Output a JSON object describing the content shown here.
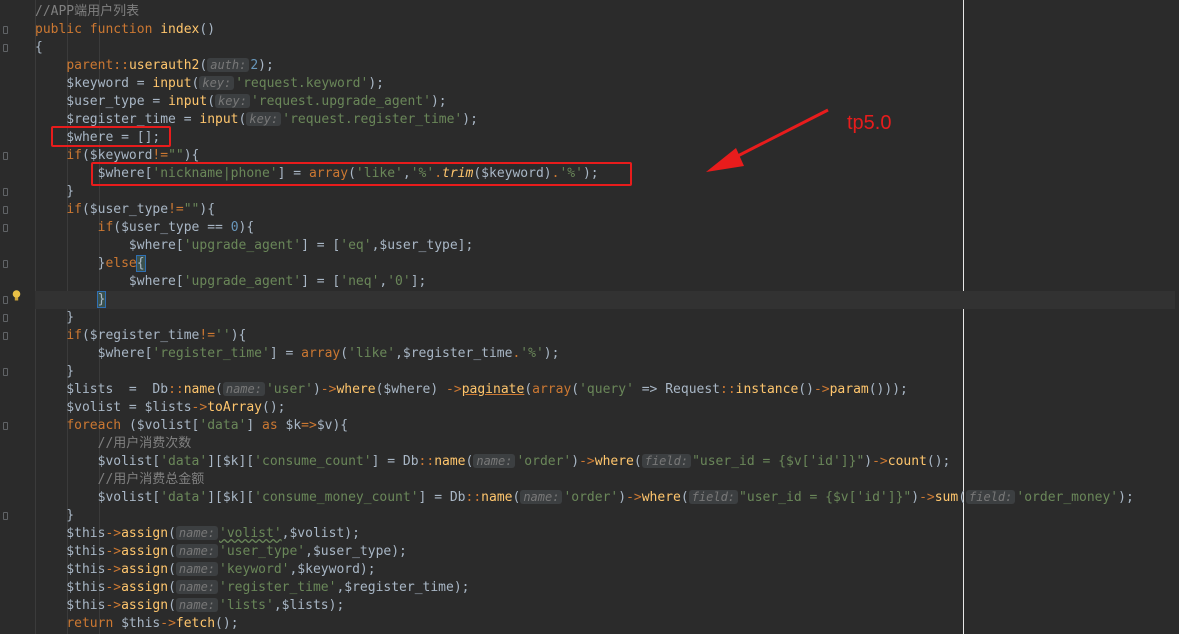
{
  "annotation": {
    "label": "tp5.0",
    "color": "#e81c1c"
  },
  "lines": [
    [
      {
        "c": "cm",
        "t": "//APP端用户列表"
      }
    ],
    [
      {
        "c": "kw",
        "t": "public function "
      },
      {
        "c": "fn",
        "t": "index"
      },
      {
        "c": "var",
        "t": "()"
      }
    ],
    [
      {
        "c": "var",
        "t": "{"
      }
    ],
    [
      {
        "c": "var",
        "t": "    "
      },
      {
        "c": "kw",
        "t": "parent"
      },
      {
        "c": "op",
        "t": "::"
      },
      {
        "c": "mth",
        "t": "userauth2"
      },
      {
        "c": "var",
        "t": "("
      },
      {
        "c": "hint",
        "t": "auth:"
      },
      {
        "c": "num",
        "t": "2"
      },
      {
        "c": "var",
        "t": ");"
      }
    ],
    [
      {
        "c": "var",
        "t": "    $keyword = "
      },
      {
        "c": "mth",
        "t": "input"
      },
      {
        "c": "var",
        "t": "("
      },
      {
        "c": "hint",
        "t": "key:"
      },
      {
        "c": "str",
        "t": "'request.keyword'"
      },
      {
        "c": "var",
        "t": ");"
      }
    ],
    [
      {
        "c": "var",
        "t": "    $user_type = "
      },
      {
        "c": "mth",
        "t": "input"
      },
      {
        "c": "var",
        "t": "("
      },
      {
        "c": "hint",
        "t": "key:"
      },
      {
        "c": "str",
        "t": "'request.upgrade_agent'"
      },
      {
        "c": "var",
        "t": ");"
      }
    ],
    [
      {
        "c": "var",
        "t": "    $register_time = "
      },
      {
        "c": "mth",
        "t": "input"
      },
      {
        "c": "var",
        "t": "("
      },
      {
        "c": "hint",
        "t": "key:"
      },
      {
        "c": "str",
        "t": "'request.register_time'"
      },
      {
        "c": "var",
        "t": ");"
      }
    ],
    [
      {
        "c": "var",
        "t": "    $where = [];"
      }
    ],
    [
      {
        "c": "var",
        "t": "    "
      },
      {
        "c": "kw",
        "t": "if"
      },
      {
        "c": "var",
        "t": "($keyword"
      },
      {
        "c": "op",
        "t": "!="
      },
      {
        "c": "str",
        "t": "\"\""
      },
      {
        "c": "var",
        "t": "){"
      }
    ],
    [
      {
        "c": "var",
        "t": "        $where["
      },
      {
        "c": "str",
        "t": "'nickname|phone'"
      },
      {
        "c": "var",
        "t": "] = "
      },
      {
        "c": "kw",
        "t": "array"
      },
      {
        "c": "var",
        "t": "("
      },
      {
        "c": "str",
        "t": "'like'"
      },
      {
        "c": "var",
        "t": ","
      },
      {
        "c": "str",
        "t": "'%'"
      },
      {
        "c": "op",
        "t": "."
      },
      {
        "c": "mth ital",
        "t": "trim"
      },
      {
        "c": "var",
        "t": "($keyword)"
      },
      {
        "c": "op",
        "t": "."
      },
      {
        "c": "str",
        "t": "'%'"
      },
      {
        "c": "var",
        "t": ");"
      }
    ],
    [
      {
        "c": "var",
        "t": "    }"
      }
    ],
    [
      {
        "c": "var",
        "t": "    "
      },
      {
        "c": "kw",
        "t": "if"
      },
      {
        "c": "var",
        "t": "($user_type"
      },
      {
        "c": "op",
        "t": "!="
      },
      {
        "c": "str",
        "t": "\"\""
      },
      {
        "c": "var",
        "t": "){"
      }
    ],
    [
      {
        "c": "var",
        "t": "        "
      },
      {
        "c": "kw",
        "t": "if"
      },
      {
        "c": "var",
        "t": "($user_type == "
      },
      {
        "c": "num",
        "t": "0"
      },
      {
        "c": "var",
        "t": "){"
      }
    ],
    [
      {
        "c": "var",
        "t": "            $where["
      },
      {
        "c": "str",
        "t": "'upgrade_agent'"
      },
      {
        "c": "var",
        "t": "] = ["
      },
      {
        "c": "str",
        "t": "'eq'"
      },
      {
        "c": "var",
        "t": ",$user_type];"
      }
    ],
    [
      {
        "c": "var",
        "t": "        }"
      },
      {
        "c": "kw",
        "t": "else"
      },
      {
        "c": "brace",
        "t": "{"
      }
    ],
    [
      {
        "c": "var",
        "t": "            $where["
      },
      {
        "c": "str",
        "t": "'upgrade_agent'"
      },
      {
        "c": "var",
        "t": "] = ["
      },
      {
        "c": "str",
        "t": "'neq'"
      },
      {
        "c": "var",
        "t": ","
      },
      {
        "c": "str",
        "t": "'0'"
      },
      {
        "c": "var",
        "t": "];"
      }
    ],
    [
      {
        "c": "var",
        "t": "        "
      },
      {
        "c": "brace",
        "t": "}"
      }
    ],
    [
      {
        "c": "var",
        "t": "    }"
      }
    ],
    [
      {
        "c": "var",
        "t": "    "
      },
      {
        "c": "kw",
        "t": "if"
      },
      {
        "c": "var",
        "t": "($register_time"
      },
      {
        "c": "op",
        "t": "!="
      },
      {
        "c": "str",
        "t": "''"
      },
      {
        "c": "var",
        "t": "){"
      }
    ],
    [
      {
        "c": "var",
        "t": "        $where["
      },
      {
        "c": "str",
        "t": "'register_time'"
      },
      {
        "c": "var",
        "t": "] = "
      },
      {
        "c": "kw",
        "t": "array"
      },
      {
        "c": "var",
        "t": "("
      },
      {
        "c": "str",
        "t": "'like'"
      },
      {
        "c": "var",
        "t": ",$register_time"
      },
      {
        "c": "op",
        "t": "."
      },
      {
        "c": "str",
        "t": "'%'"
      },
      {
        "c": "var",
        "t": ");"
      }
    ],
    [
      {
        "c": "var",
        "t": "    }"
      }
    ],
    [
      {
        "c": "var",
        "t": "    $lists  =  Db"
      },
      {
        "c": "op",
        "t": "::"
      },
      {
        "c": "mth",
        "t": "name"
      },
      {
        "c": "var",
        "t": "("
      },
      {
        "c": "hint",
        "t": "name:"
      },
      {
        "c": "str",
        "t": "'user'"
      },
      {
        "c": "var",
        "t": ")"
      },
      {
        "c": "op",
        "t": "->"
      },
      {
        "c": "mth",
        "t": "where"
      },
      {
        "c": "var",
        "t": "($where) "
      },
      {
        "c": "op",
        "t": "->"
      },
      {
        "c": "mth under",
        "t": "paginate"
      },
      {
        "c": "var",
        "t": "("
      },
      {
        "c": "kw",
        "t": "array"
      },
      {
        "c": "var",
        "t": "("
      },
      {
        "c": "str",
        "t": "'query'"
      },
      {
        "c": "var",
        "t": " => Request"
      },
      {
        "c": "op",
        "t": "::"
      },
      {
        "c": "mth",
        "t": "instance"
      },
      {
        "c": "var",
        "t": "()"
      },
      {
        "c": "op",
        "t": "->"
      },
      {
        "c": "mth",
        "t": "param"
      },
      {
        "c": "var",
        "t": "()));"
      }
    ],
    [
      {
        "c": "var",
        "t": "    $volist = $lists"
      },
      {
        "c": "op",
        "t": "->"
      },
      {
        "c": "mth",
        "t": "toArray"
      },
      {
        "c": "var",
        "t": "();"
      }
    ],
    [
      {
        "c": "var",
        "t": "    "
      },
      {
        "c": "kw",
        "t": "foreach "
      },
      {
        "c": "var",
        "t": "($volist["
      },
      {
        "c": "str",
        "t": "'data'"
      },
      {
        "c": "var",
        "t": "] "
      },
      {
        "c": "kw",
        "t": "as "
      },
      {
        "c": "var",
        "t": "$k"
      },
      {
        "c": "op",
        "t": "=>"
      },
      {
        "c": "var",
        "t": "$v){"
      }
    ],
    [
      {
        "c": "cm",
        "t": "        //用户消费次数"
      }
    ],
    [
      {
        "c": "var",
        "t": "        $volist["
      },
      {
        "c": "str",
        "t": "'data'"
      },
      {
        "c": "var",
        "t": "][$k]["
      },
      {
        "c": "str",
        "t": "'consume_count'"
      },
      {
        "c": "var",
        "t": "] = Db"
      },
      {
        "c": "op",
        "t": "::"
      },
      {
        "c": "mth",
        "t": "name"
      },
      {
        "c": "var",
        "t": "("
      },
      {
        "c": "hint",
        "t": "name:"
      },
      {
        "c": "str",
        "t": "'order'"
      },
      {
        "c": "var",
        "t": ")"
      },
      {
        "c": "op",
        "t": "->"
      },
      {
        "c": "mth",
        "t": "where"
      },
      {
        "c": "var",
        "t": "("
      },
      {
        "c": "hint",
        "t": "field:"
      },
      {
        "c": "str",
        "t": "\"user_id = {$v['id']}\""
      },
      {
        "c": "var",
        "t": ")"
      },
      {
        "c": "op",
        "t": "->"
      },
      {
        "c": "mth",
        "t": "count"
      },
      {
        "c": "var",
        "t": "();"
      }
    ],
    [
      {
        "c": "cm",
        "t": "        //用户消费总金额"
      }
    ],
    [
      {
        "c": "var",
        "t": "        $volist["
      },
      {
        "c": "str",
        "t": "'data'"
      },
      {
        "c": "var",
        "t": "][$k]["
      },
      {
        "c": "str",
        "t": "'consume_money_count'"
      },
      {
        "c": "var",
        "t": "] = Db"
      },
      {
        "c": "op",
        "t": "::"
      },
      {
        "c": "mth",
        "t": "name"
      },
      {
        "c": "var",
        "t": "("
      },
      {
        "c": "hint",
        "t": "name:"
      },
      {
        "c": "str",
        "t": "'order'"
      },
      {
        "c": "var",
        "t": ")"
      },
      {
        "c": "op",
        "t": "->"
      },
      {
        "c": "mth",
        "t": "where"
      },
      {
        "c": "var",
        "t": "("
      },
      {
        "c": "hint",
        "t": "field:"
      },
      {
        "c": "str",
        "t": "\"user_id = {$v['id']}\""
      },
      {
        "c": "var",
        "t": ")"
      },
      {
        "c": "op",
        "t": "->"
      },
      {
        "c": "mth",
        "t": "sum"
      },
      {
        "c": "var",
        "t": "("
      },
      {
        "c": "hint",
        "t": "field:"
      },
      {
        "c": "str",
        "t": "'order_money'"
      },
      {
        "c": "var",
        "t": ");"
      }
    ],
    [
      {
        "c": "var",
        "t": "    }"
      }
    ],
    [
      {
        "c": "var",
        "t": "    $this"
      },
      {
        "c": "op",
        "t": "->"
      },
      {
        "c": "mth",
        "t": "assign"
      },
      {
        "c": "var",
        "t": "("
      },
      {
        "c": "hint",
        "t": "name:"
      },
      {
        "c": "str wavy",
        "t": "'volist'"
      },
      {
        "c": "var",
        "t": ",$volist);"
      }
    ],
    [
      {
        "c": "var",
        "t": "    $this"
      },
      {
        "c": "op",
        "t": "->"
      },
      {
        "c": "mth",
        "t": "assign"
      },
      {
        "c": "var",
        "t": "("
      },
      {
        "c": "hint",
        "t": "name:"
      },
      {
        "c": "str",
        "t": "'user_type'"
      },
      {
        "c": "var",
        "t": ",$user_type);"
      }
    ],
    [
      {
        "c": "var",
        "t": "    $this"
      },
      {
        "c": "op",
        "t": "->"
      },
      {
        "c": "mth",
        "t": "assign"
      },
      {
        "c": "var",
        "t": "("
      },
      {
        "c": "hint",
        "t": "name:"
      },
      {
        "c": "str",
        "t": "'keyword'"
      },
      {
        "c": "var",
        "t": ",$keyword);"
      }
    ],
    [
      {
        "c": "var",
        "t": "    $this"
      },
      {
        "c": "op",
        "t": "->"
      },
      {
        "c": "mth",
        "t": "assign"
      },
      {
        "c": "var",
        "t": "("
      },
      {
        "c": "hint",
        "t": "name:"
      },
      {
        "c": "str",
        "t": "'register_time'"
      },
      {
        "c": "var",
        "t": ",$register_time);"
      }
    ],
    [
      {
        "c": "var",
        "t": "    $this"
      },
      {
        "c": "op",
        "t": "->"
      },
      {
        "c": "mth",
        "t": "assign"
      },
      {
        "c": "var",
        "t": "("
      },
      {
        "c": "hint",
        "t": "name:"
      },
      {
        "c": "str",
        "t": "'lists'"
      },
      {
        "c": "var",
        "t": ",$lists);"
      }
    ],
    [
      {
        "c": "var",
        "t": "    "
      },
      {
        "c": "kw",
        "t": "return "
      },
      {
        "c": "var",
        "t": "$this"
      },
      {
        "c": "op",
        "t": "->"
      },
      {
        "c": "mth",
        "t": "fetch"
      },
      {
        "c": "var",
        "t": "();"
      }
    ]
  ]
}
